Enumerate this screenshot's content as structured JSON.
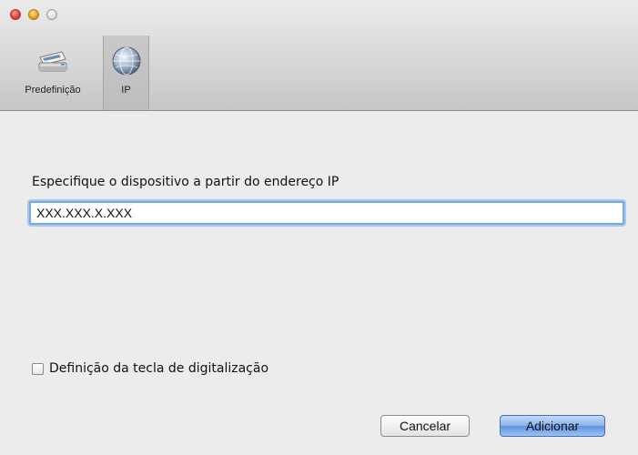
{
  "toolbar": {
    "tabs": [
      {
        "label": "Predefinição",
        "icon": "scanner-icon"
      },
      {
        "label": "IP",
        "icon": "globe-icon",
        "selected": true
      }
    ]
  },
  "content": {
    "ip_label": "Especifique o dispositivo a partir do endereço IP",
    "ip_value": "XXX.XXX.X.XXX",
    "scan_key_label": "Definição da tecla de digitalização",
    "scan_key_checked": false
  },
  "buttons": {
    "cancel": "Cancelar",
    "add": "Adicionar"
  }
}
